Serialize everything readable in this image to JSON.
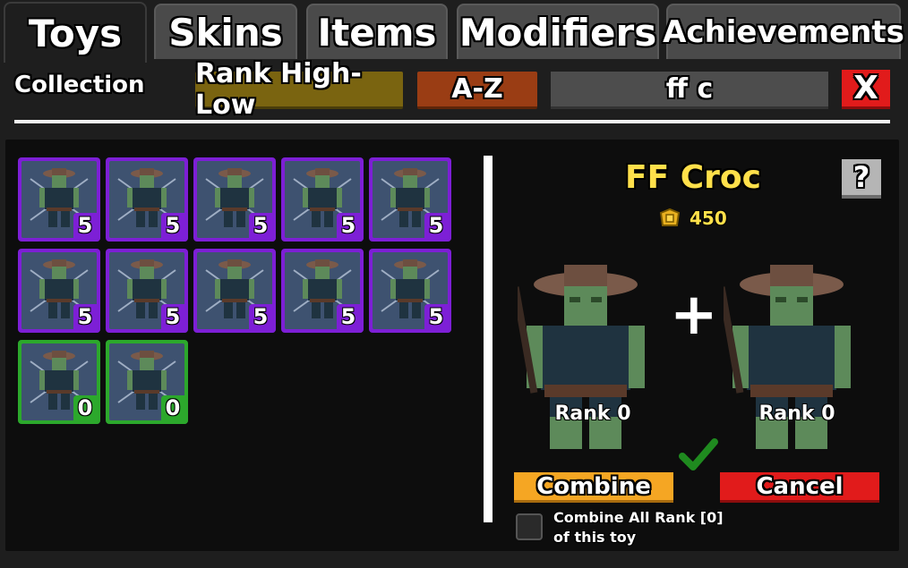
{
  "tabs": [
    {
      "label": "Toys",
      "active": true
    },
    {
      "label": "Skins",
      "active": false
    },
    {
      "label": "Items",
      "active": false
    },
    {
      "label": "Modifiers",
      "active": false
    },
    {
      "label": "Achievements",
      "active": false
    }
  ],
  "toolbar": {
    "collection_label": "Collection",
    "sort_rank_label": "Rank High-Low",
    "sort_az_label": "A-Z",
    "search_value": "ff c",
    "close_label": "X"
  },
  "inventory": [
    {
      "rank": "5",
      "rarity": "purple"
    },
    {
      "rank": "5",
      "rarity": "purple"
    },
    {
      "rank": "5",
      "rarity": "purple"
    },
    {
      "rank": "5",
      "rarity": "purple"
    },
    {
      "rank": "5",
      "rarity": "purple"
    },
    {
      "rank": "5",
      "rarity": "purple"
    },
    {
      "rank": "5",
      "rarity": "purple"
    },
    {
      "rank": "5",
      "rarity": "purple"
    },
    {
      "rank": "5",
      "rarity": "purple"
    },
    {
      "rank": "5",
      "rarity": "purple"
    },
    {
      "rank": "0",
      "rarity": "green"
    },
    {
      "rank": "0",
      "rarity": "green"
    }
  ],
  "details": {
    "name": "FF Croc",
    "help_label": "?",
    "price": "450",
    "plus": "+",
    "left_rank": "Rank 0",
    "right_rank": "Rank 0",
    "combine_label": "Combine",
    "cancel_label": "Cancel",
    "combine_all_line1": "Combine All Rank [0]",
    "combine_all_line2": "of this toy"
  },
  "colors": {
    "purple": "#7d1fd6",
    "green": "#2ca82c",
    "gold": "#ffe04a",
    "combine": "#f5a623",
    "cancel": "#e11b1b"
  }
}
